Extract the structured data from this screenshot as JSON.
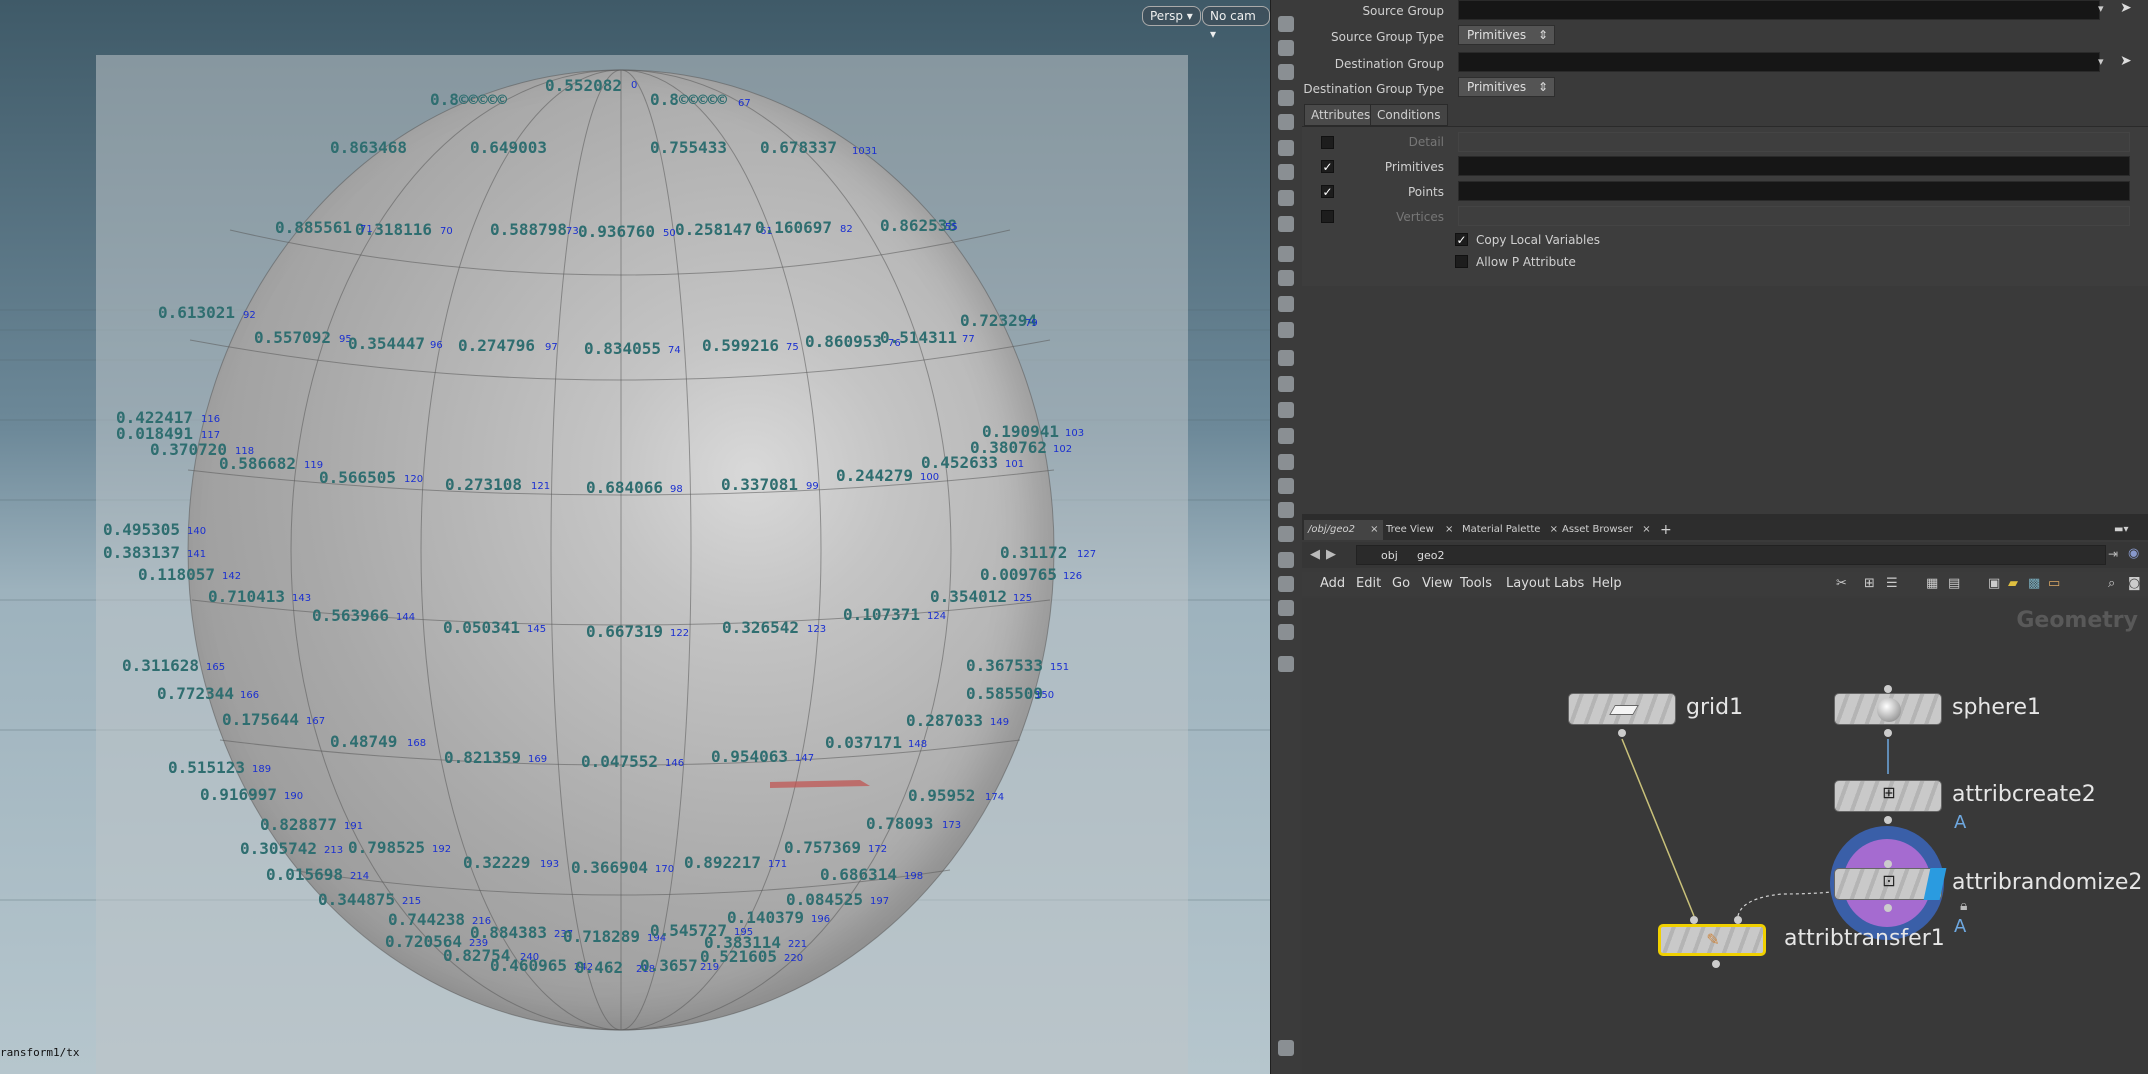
{
  "viewport": {
    "camera_menu": "Persp ▾",
    "cam_menu": "No cam ▾",
    "status_text": "ransform1/tx",
    "labels": [
      [
        "0.552082",
        "0",
        545,
        78,
        631,
        80
      ],
      [
        "0.8©©©©©",
        "",
        430,
        92,
        0,
        0
      ],
      [
        "0.649003",
        "",
        470,
        140,
        0,
        0
      ],
      [
        "0.588798",
        "73",
        490,
        222,
        566,
        226
      ],
      [
        "0.613021",
        "92",
        158,
        305,
        243,
        310
      ],
      [
        "0.557092",
        "95",
        254,
        330,
        339,
        334
      ],
      [
        "0.354447",
        "96",
        348,
        336,
        430,
        340
      ],
      [
        "0.274796",
        "97",
        458,
        338,
        545,
        342
      ],
      [
        "0.834055",
        "74",
        584,
        341,
        668,
        345
      ],
      [
        "0.599216",
        "75",
        702,
        338,
        786,
        342
      ],
      [
        "0.860953",
        "76",
        805,
        334,
        888,
        338
      ],
      [
        "0.514311",
        "77",
        880,
        330,
        962,
        334
      ],
      [
        "0.723294",
        "79",
        960,
        313,
        1025,
        318
      ],
      [
        "0.422417",
        "116",
        116,
        410,
        201,
        414
      ],
      [
        "0.018491",
        "117",
        116,
        426,
        201,
        430
      ],
      [
        "0.370720",
        "118",
        150,
        442,
        235,
        446
      ],
      [
        "0.586682",
        "119",
        219,
        456,
        304,
        460
      ],
      [
        "0.566505",
        "120",
        319,
        470,
        404,
        474
      ],
      [
        "0.273108",
        "121",
        445,
        477,
        531,
        481
      ],
      [
        "0.684066",
        "98",
        586,
        480,
        670,
        484
      ],
      [
        "0.337081",
        "99",
        721,
        477,
        806,
        481
      ],
      [
        "0.244279",
        "100",
        836,
        468,
        920,
        472
      ],
      [
        "0.452633",
        "101",
        921,
        455,
        1005,
        459
      ],
      [
        "0.380762",
        "102",
        970,
        440,
        1053,
        444
      ],
      [
        "0.190941",
        "103",
        982,
        424,
        1065,
        428
      ],
      [
        "0.495305",
        "140",
        103,
        522,
        187,
        526
      ],
      [
        "0.383137",
        "141",
        103,
        545,
        187,
        549
      ],
      [
        "0.118057",
        "142",
        138,
        567,
        222,
        571
      ],
      [
        "0.710413",
        "143",
        208,
        589,
        292,
        593
      ],
      [
        "0.563966",
        "144",
        312,
        608,
        396,
        612
      ],
      [
        "0.050341",
        "145",
        443,
        620,
        527,
        624
      ],
      [
        "0.667319",
        "122",
        586,
        624,
        670,
        628
      ],
      [
        "0.326542",
        "123",
        722,
        620,
        807,
        624
      ],
      [
        "0.107371",
        "124",
        843,
        607,
        927,
        611
      ],
      [
        "0.354012",
        "125",
        930,
        589,
        1013,
        593
      ],
      [
        "0.009765",
        "126",
        980,
        567,
        1063,
        571
      ],
      [
        "0.31172",
        "127",
        1000,
        545,
        1077,
        549
      ],
      [
        "0.311628",
        "165",
        122,
        658,
        206,
        662
      ],
      [
        "0.772344",
        "166",
        157,
        686,
        240,
        690
      ],
      [
        "0.175644",
        "167",
        222,
        712,
        306,
        716
      ],
      [
        "0.48749",
        "168",
        330,
        734,
        407,
        738
      ],
      [
        "0.821359",
        "169",
        444,
        750,
        528,
        754
      ],
      [
        "0.047552",
        "146",
        581,
        754,
        665,
        758
      ],
      [
        "0.954063",
        "147",
        711,
        749,
        795,
        753
      ],
      [
        "0.037171",
        "148",
        825,
        735,
        908,
        739
      ],
      [
        "0.287033",
        "149",
        906,
        713,
        990,
        717
      ],
      [
        "0.585509",
        "150",
        966,
        686,
        1035,
        690
      ],
      [
        "0.367533",
        "151",
        966,
        658,
        1050,
        662
      ],
      [
        "0.515123",
        "189",
        168,
        760,
        252,
        764
      ],
      [
        "0.916997",
        "190",
        200,
        787,
        284,
        791
      ],
      [
        "0.828877",
        "191",
        260,
        817,
        344,
        821
      ],
      [
        "0.305742",
        "213",
        240,
        841,
        324,
        845
      ],
      [
        "0.798525",
        "192",
        348,
        840,
        432,
        844
      ],
      [
        "0.015698",
        "214",
        266,
        867,
        350,
        871
      ],
      [
        "0.32229",
        "193",
        463,
        855,
        540,
        859
      ],
      [
        "0.366904",
        "170",
        571,
        860,
        655,
        864
      ],
      [
        "0.892217",
        "171",
        684,
        855,
        768,
        859
      ],
      [
        "0.757369",
        "172",
        784,
        840,
        868,
        844
      ],
      [
        "0.78093",
        "173",
        866,
        816,
        942,
        820
      ],
      [
        "0.95952",
        "174",
        908,
        788,
        985,
        792
      ],
      [
        "0.686314",
        "198",
        820,
        867,
        904,
        871
      ],
      [
        "0.084525",
        "197",
        786,
        892,
        870,
        896
      ],
      [
        "0.344875",
        "215",
        318,
        892,
        402,
        896
      ],
      [
        "0.744238",
        "216",
        388,
        912,
        472,
        916
      ],
      [
        "0.140379",
        "196",
        727,
        910,
        811,
        914
      ],
      [
        "0.720564",
        "239",
        385,
        934,
        469,
        938
      ],
      [
        "0.884383",
        "237",
        470,
        925,
        554,
        929
      ],
      [
        "0.718289",
        "194",
        563,
        929,
        647,
        933
      ],
      [
        "0.545727",
        "195",
        650,
        923,
        734,
        927
      ],
      [
        "0.383114",
        "221",
        704,
        935,
        788,
        939
      ],
      [
        "0.82754",
        "240",
        443,
        948,
        520,
        952
      ],
      [
        "0.521605",
        "220",
        700,
        949,
        784,
        953
      ],
      [
        "0.460965",
        "242",
        490,
        958,
        574,
        962
      ],
      [
        "0.462",
        "218",
        575,
        960,
        636,
        964
      ],
      [
        "0.3657",
        "219",
        640,
        958,
        700,
        962
      ],
      [
        "0.318116",
        "70",
        355,
        222,
        440,
        226
      ],
      [
        "0.936760",
        "50",
        578,
        224,
        663,
        228
      ],
      [
        "0.258147",
        "61",
        675,
        222,
        760,
        226
      ],
      [
        "0.160697",
        "82",
        755,
        220,
        840,
        224
      ],
      [
        "0.885561",
        "71",
        275,
        220,
        360,
        224
      ],
      [
        "0.862538",
        "55",
        880,
        218,
        945,
        222
      ],
      [
        "0.863468",
        "",
        330,
        140,
        0,
        0
      ],
      [
        "0.755433",
        "",
        650,
        140,
        0,
        0
      ],
      [
        "0.678337",
        "1031",
        760,
        140,
        852,
        146
      ],
      [
        "0.8©©©©©",
        "67",
        650,
        92,
        738,
        98
      ]
    ]
  },
  "params": {
    "source_group_label": "Source Group",
    "source_group_type_label": "Source Group Type",
    "source_group_type_value": "Primitives",
    "dest_group_label": "Destination Group",
    "dest_group_type_label": "Destination Group Type",
    "dest_group_type_value": "Primitives",
    "tab_attributes": "Attributes",
    "tab_conditions": "Conditions",
    "detail_label": "Detail",
    "primitives_label": "Primitives",
    "points_label": "Points",
    "vertices_label": "Vertices",
    "copy_local_label": "Copy Local Variables",
    "allow_p_label": "Allow P Attribute"
  },
  "network": {
    "tabs": [
      "/obj/geo2",
      "Tree View",
      "Material Palette",
      "Asset Browser"
    ],
    "path_obj": "obj",
    "path_geo": "geo2",
    "menu": [
      "Add",
      "Edit",
      "Go",
      "View",
      "Tools",
      "Layout",
      "Labs",
      "Help"
    ],
    "context_label": "Geometry",
    "nodes": {
      "grid1": "grid1",
      "sphere1": "sphere1",
      "attribcreate2": "attribcreate2",
      "attribrandomize2": "attribrandomize2",
      "attribtransfer1": "attribtransfer1",
      "flag_a": "A"
    }
  },
  "colors": {
    "attr_text": "#2f6e70",
    "point_index": "#1a2fd0",
    "selected_node": "#f0d000",
    "randomize_ring": "#3a5fa8"
  }
}
